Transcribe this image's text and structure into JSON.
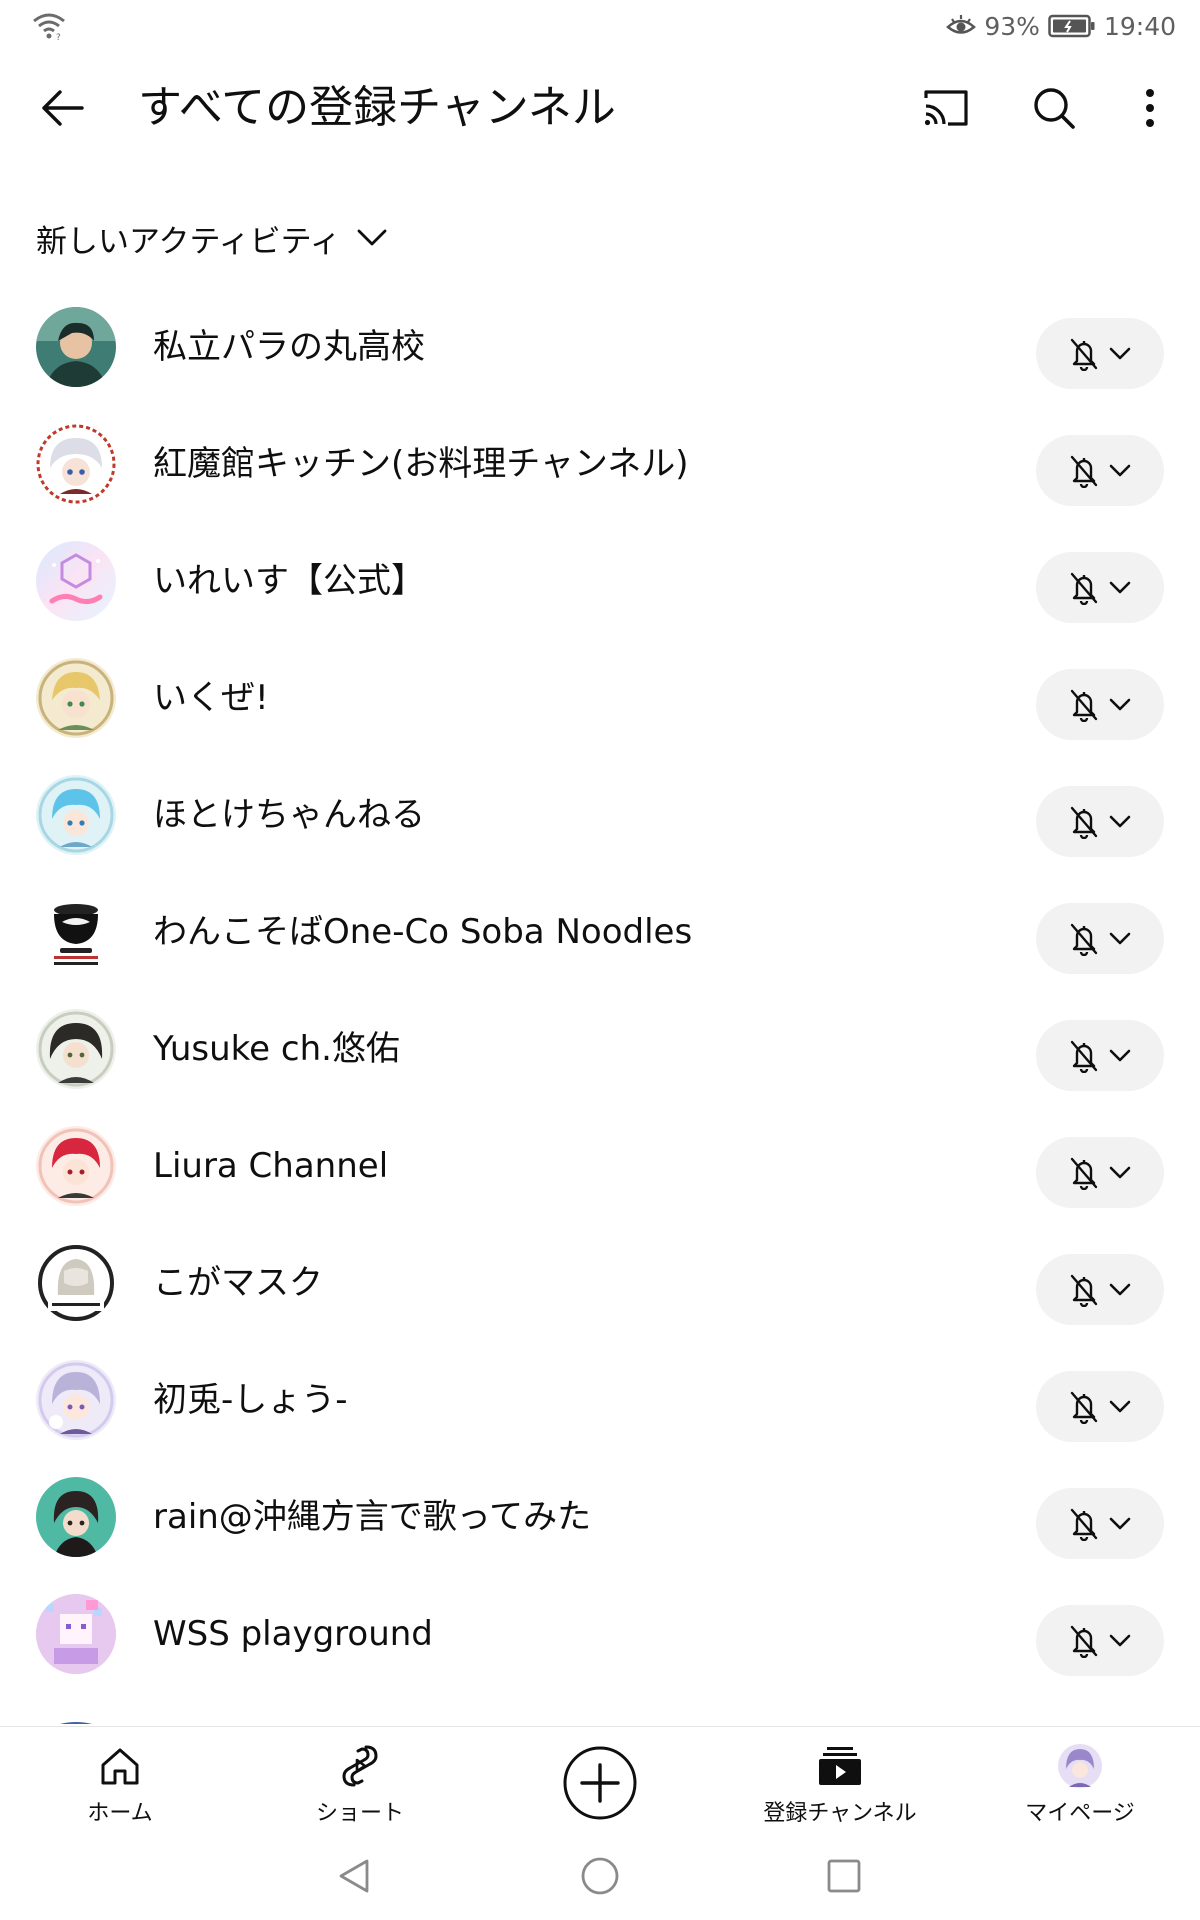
{
  "status_bar": {
    "battery_percent": "93%",
    "time": "19:40"
  },
  "header": {
    "title": "すべての登録チャンネル"
  },
  "sort": {
    "label": "新しいアクティビティ"
  },
  "channels": [
    {
      "name": "私立パラの丸高校"
    },
    {
      "name": "紅魔館キッチン(お料理チャンネル)"
    },
    {
      "name": "いれいす【公式】"
    },
    {
      "name": "いくぜ!"
    },
    {
      "name": "ほとけちゃんねる"
    },
    {
      "name": "わんこそばOne-Co Soba Noodles"
    },
    {
      "name": "Yusuke ch.悠佑"
    },
    {
      "name": "Liura Channel"
    },
    {
      "name": "こがマスク"
    },
    {
      "name": "初兎-しょう-"
    },
    {
      "name": "rain@沖縄方言で歌ってみた"
    },
    {
      "name": "WSS playground"
    }
  ],
  "bottom_nav": {
    "home": "ホーム",
    "shorts": "ショート",
    "subscriptions": "登録チャンネル",
    "mypage": "マイページ"
  },
  "icons": {
    "back": "arrow-left-icon",
    "cast": "cast-icon",
    "search": "search-icon",
    "more": "more-vertical-icon",
    "notify": "bell-off-icon",
    "create": "plus-circle-icon"
  },
  "colors": {
    "text": "#0f0f0f",
    "button_bg": "#f2f2f2",
    "status_text": "#5f5f5f"
  }
}
